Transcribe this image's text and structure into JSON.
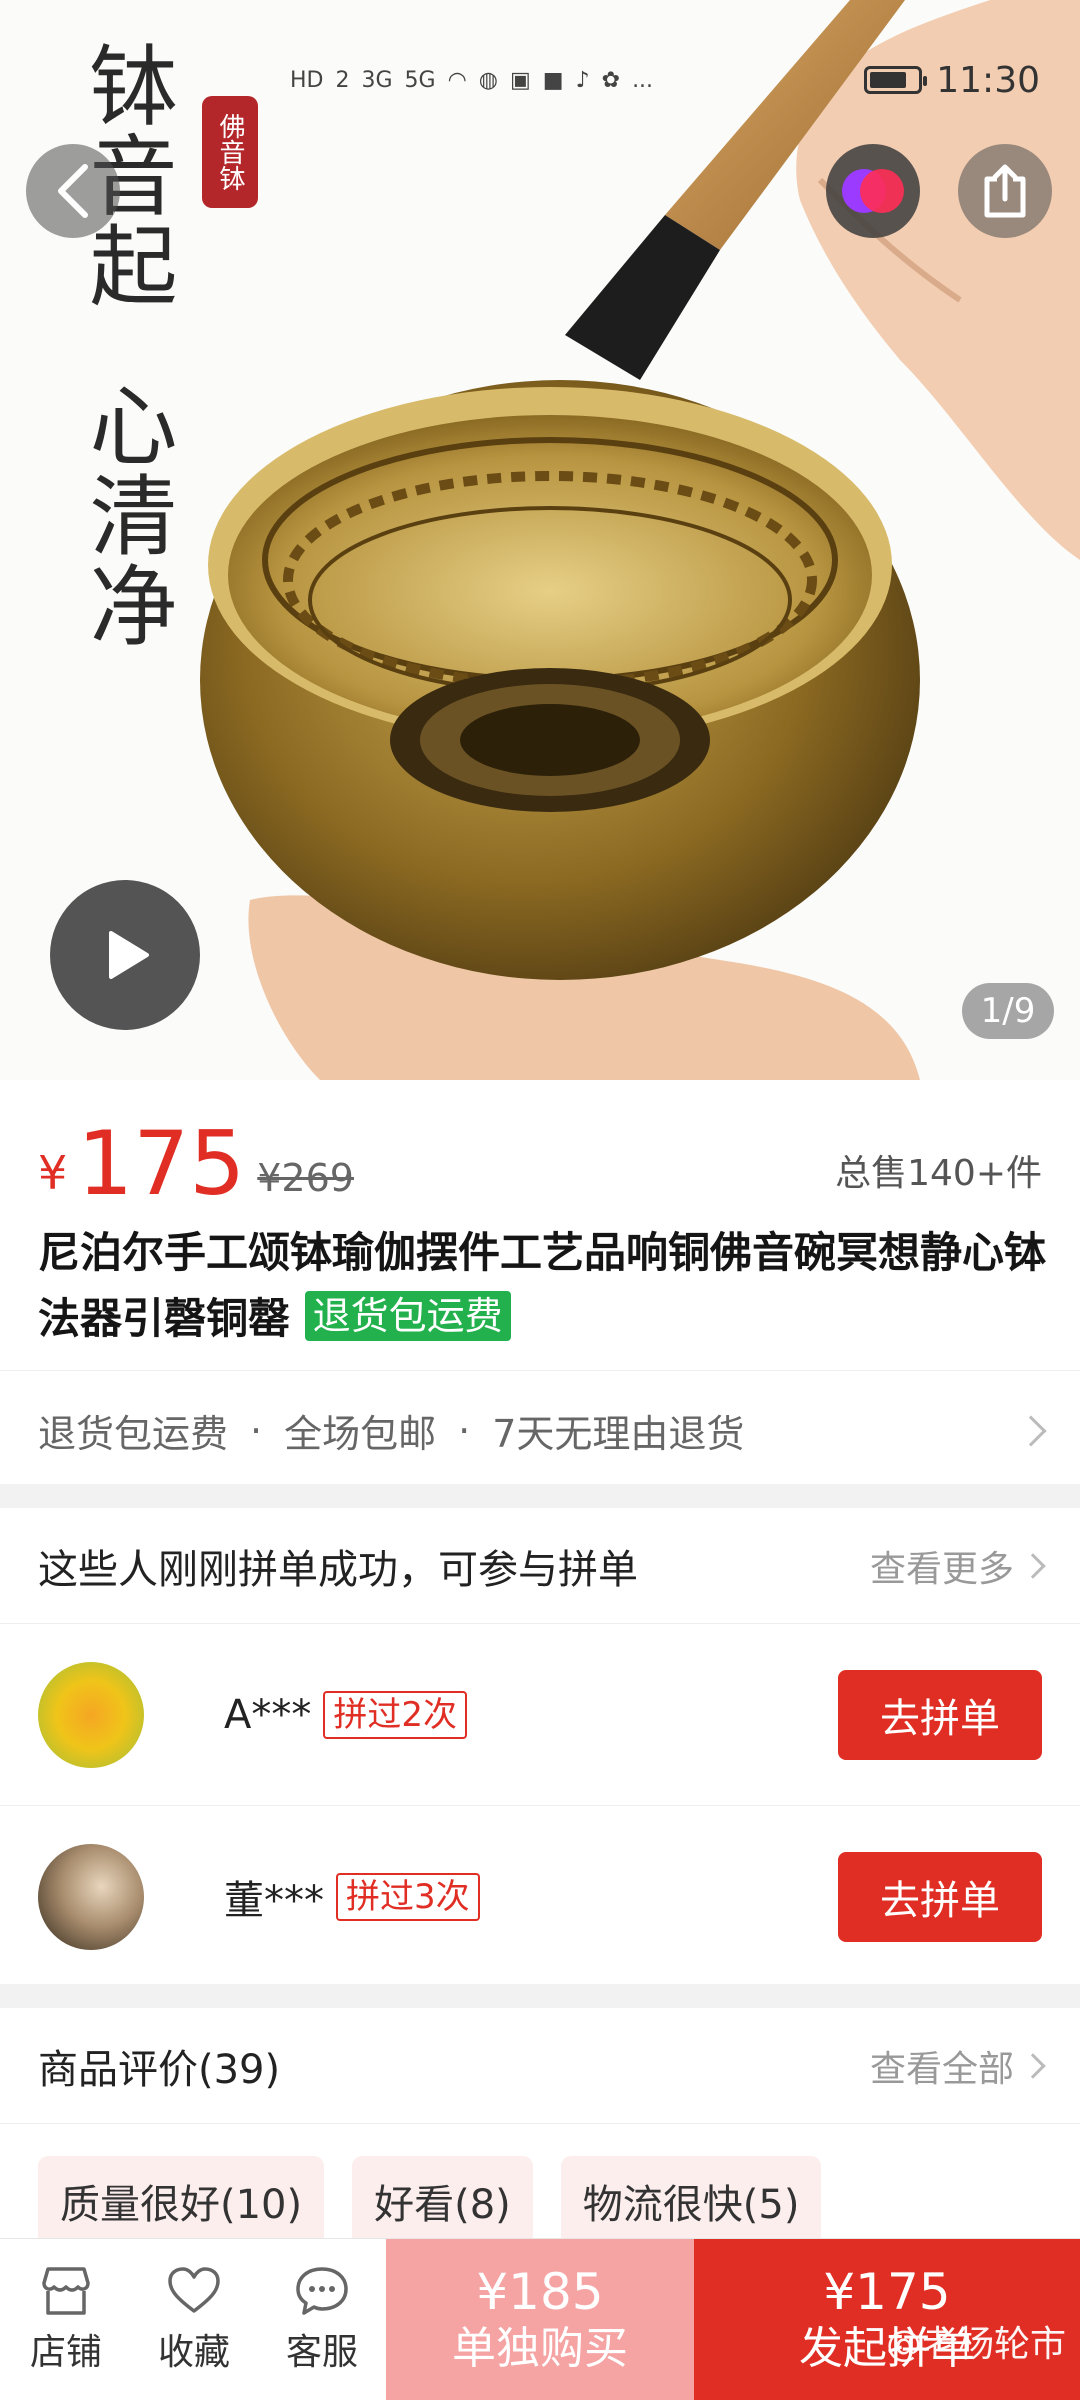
{
  "status_bar": {
    "icons": [
      "HD",
      "2",
      "3G",
      "5G",
      "wifi-icon",
      "globe-icon",
      "app-icon",
      "chat-icon",
      "tiktok-icon",
      "baidu-icon",
      "..."
    ],
    "time": "11:30"
  },
  "hero": {
    "calligraphy_1": "钵音起",
    "calligraphy_2": "心清净",
    "seal_text": "佛音钵",
    "page_counter": "1/9"
  },
  "product": {
    "currency": "¥",
    "price": "175",
    "original_price": "¥269",
    "sold": "总售140+件",
    "title": "尼泊尔手工颂钵瑜伽摆件工艺品响铜佛音碗冥想静心钵法器引磬铜罄",
    "title_tag": "退货包运费"
  },
  "services": {
    "items": [
      "退货包运费",
      "全场包邮",
      "7天无理由退货"
    ],
    "sep": "·"
  },
  "group_buy": {
    "heading": "这些人刚刚拼单成功，可参与拼单",
    "more": "查看更多",
    "rows": [
      {
        "name": "A***",
        "tag": "拼过2次",
        "button": "去拼单"
      },
      {
        "name": "董***",
        "tag": "拼过3次",
        "button": "去拼单"
      }
    ]
  },
  "reviews": {
    "heading": "商品评价(39)",
    "more": "查看全部",
    "chips": [
      "质量很好(10)",
      "好看(8)",
      "物流很快(5)"
    ]
  },
  "bottom_bar": {
    "tabs": [
      {
        "label": "店铺",
        "icon": "store-icon"
      },
      {
        "label": "收藏",
        "icon": "heart-icon"
      },
      {
        "label": "客服",
        "icon": "chat-bubble-icon"
      }
    ],
    "single": {
      "price": "¥185",
      "label": "单独购买"
    },
    "group": {
      "price": "¥175",
      "label": "发起拼单"
    },
    "watermark": "@老杨轮市"
  },
  "colors": {
    "accent": "#e02e24",
    "single_buy": "#f5a3a3",
    "tag_green": "#22b14c",
    "chip_bg": "#fdeeee"
  }
}
